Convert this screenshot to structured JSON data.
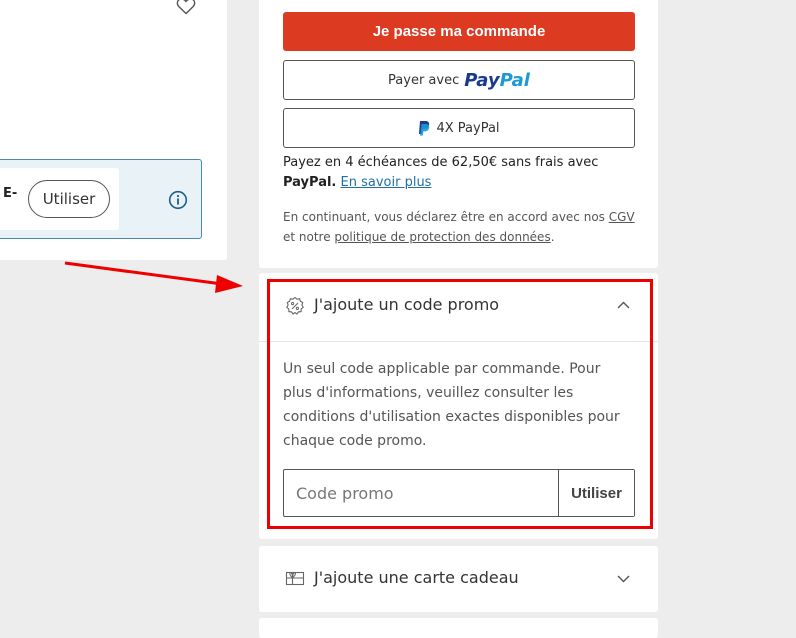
{
  "left_panel": {
    "voucher_fragment": "E-",
    "use_button": "Utiliser"
  },
  "checkout": {
    "order_button": "Je passe ma commande",
    "paypal_button": {
      "prefix": "Payer avec",
      "brand_pay": "Pay",
      "brand_pal": "Pal"
    },
    "paypal_4x_button": "4X PayPal",
    "installments": {
      "text": "Payez en 4 échéances de 62,50€ sans frais avec ",
      "brand": "PayPal.",
      "link": "En savoir plus"
    },
    "legal": {
      "part1": "En continuant, vous déclarez être en accord avec nos ",
      "cgv": "CGV",
      "part2": " et notre ",
      "privacy_link": "politique de protection des données",
      "part3": "."
    }
  },
  "promo": {
    "title": "J'ajoute un code promo",
    "description": "Un seul code applicable par commande. Pour plus d'informations, veuillez consulter les conditions d'utilisation exactes disponibles pour chaque code promo.",
    "input_placeholder": "Code promo",
    "submit_label": "Utiliser",
    "expanded": true
  },
  "gift_card": {
    "title": "J'ajoute une carte cadeau",
    "expanded": false
  },
  "colors": {
    "order_button": "#dd3a22",
    "annotation_red": "#ee0000",
    "link_blue": "#1f6fa6",
    "paypal_dark": "#1a3a8c",
    "paypal_light": "#1b9ad6"
  },
  "icons": [
    "heart-icon",
    "info-icon",
    "paypal-logo-icon",
    "percent-badge-icon",
    "chevron-up-icon",
    "gift-icon",
    "chevron-down-icon"
  ]
}
